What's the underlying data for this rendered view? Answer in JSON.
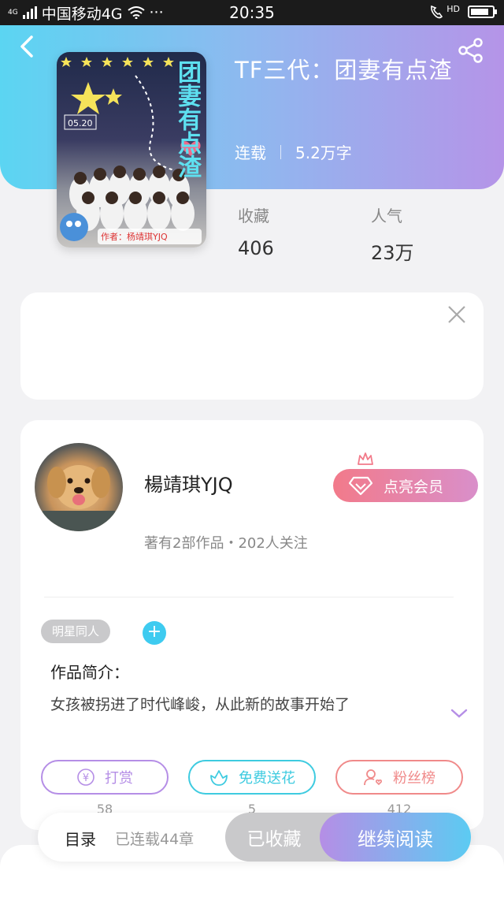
{
  "status_bar": {
    "carrier": "中国移动4G",
    "network_badge": "4G",
    "more": "···",
    "time": "20:35",
    "call_badge": "HD",
    "battery_level": 0.85
  },
  "book": {
    "title": "TF三代：团妻有点渣",
    "status": "连载",
    "word_count": "5.2万字",
    "cover_title": "团妻有点渣",
    "cover_author": "作者：杨靖琪YJQ"
  },
  "stats": [
    {
      "label": "收藏",
      "value": "406"
    },
    {
      "label": "人气",
      "value": "23万"
    }
  ],
  "author": {
    "name": "楊靖琪YJQ",
    "meta": "著有2部作品・202人关注",
    "vip_button": "点亮会员"
  },
  "tags": {
    "first": "明星同人",
    "add": "+"
  },
  "intro": {
    "title": "作品简介：",
    "text": "女孩被拐进了时代峰峻，从此新的故事开始了"
  },
  "actions": [
    {
      "label": "打赏",
      "count": "58",
      "color": "#b58ee6",
      "icon": "yen-coin-icon"
    },
    {
      "label": "免费送花",
      "count": "5",
      "color": "#3ecbe0",
      "icon": "flower-icon"
    },
    {
      "label": "粉丝榜",
      "count": "412",
      "color": "#f08a8a",
      "icon": "person-heart-icon"
    }
  ],
  "bottom_bar": {
    "toc_label": "目录",
    "toc_count": "已连载44章",
    "favorite_button": "已收藏",
    "read_button": "继续阅读"
  },
  "colors": {
    "header_gradient_start": "#5bd5f2",
    "header_gradient_end": "#b594e8",
    "accent_blue": "#3ecbf0",
    "vip_gradient_start": "#f27a8a",
    "vip_gradient_end": "#d98fca"
  }
}
